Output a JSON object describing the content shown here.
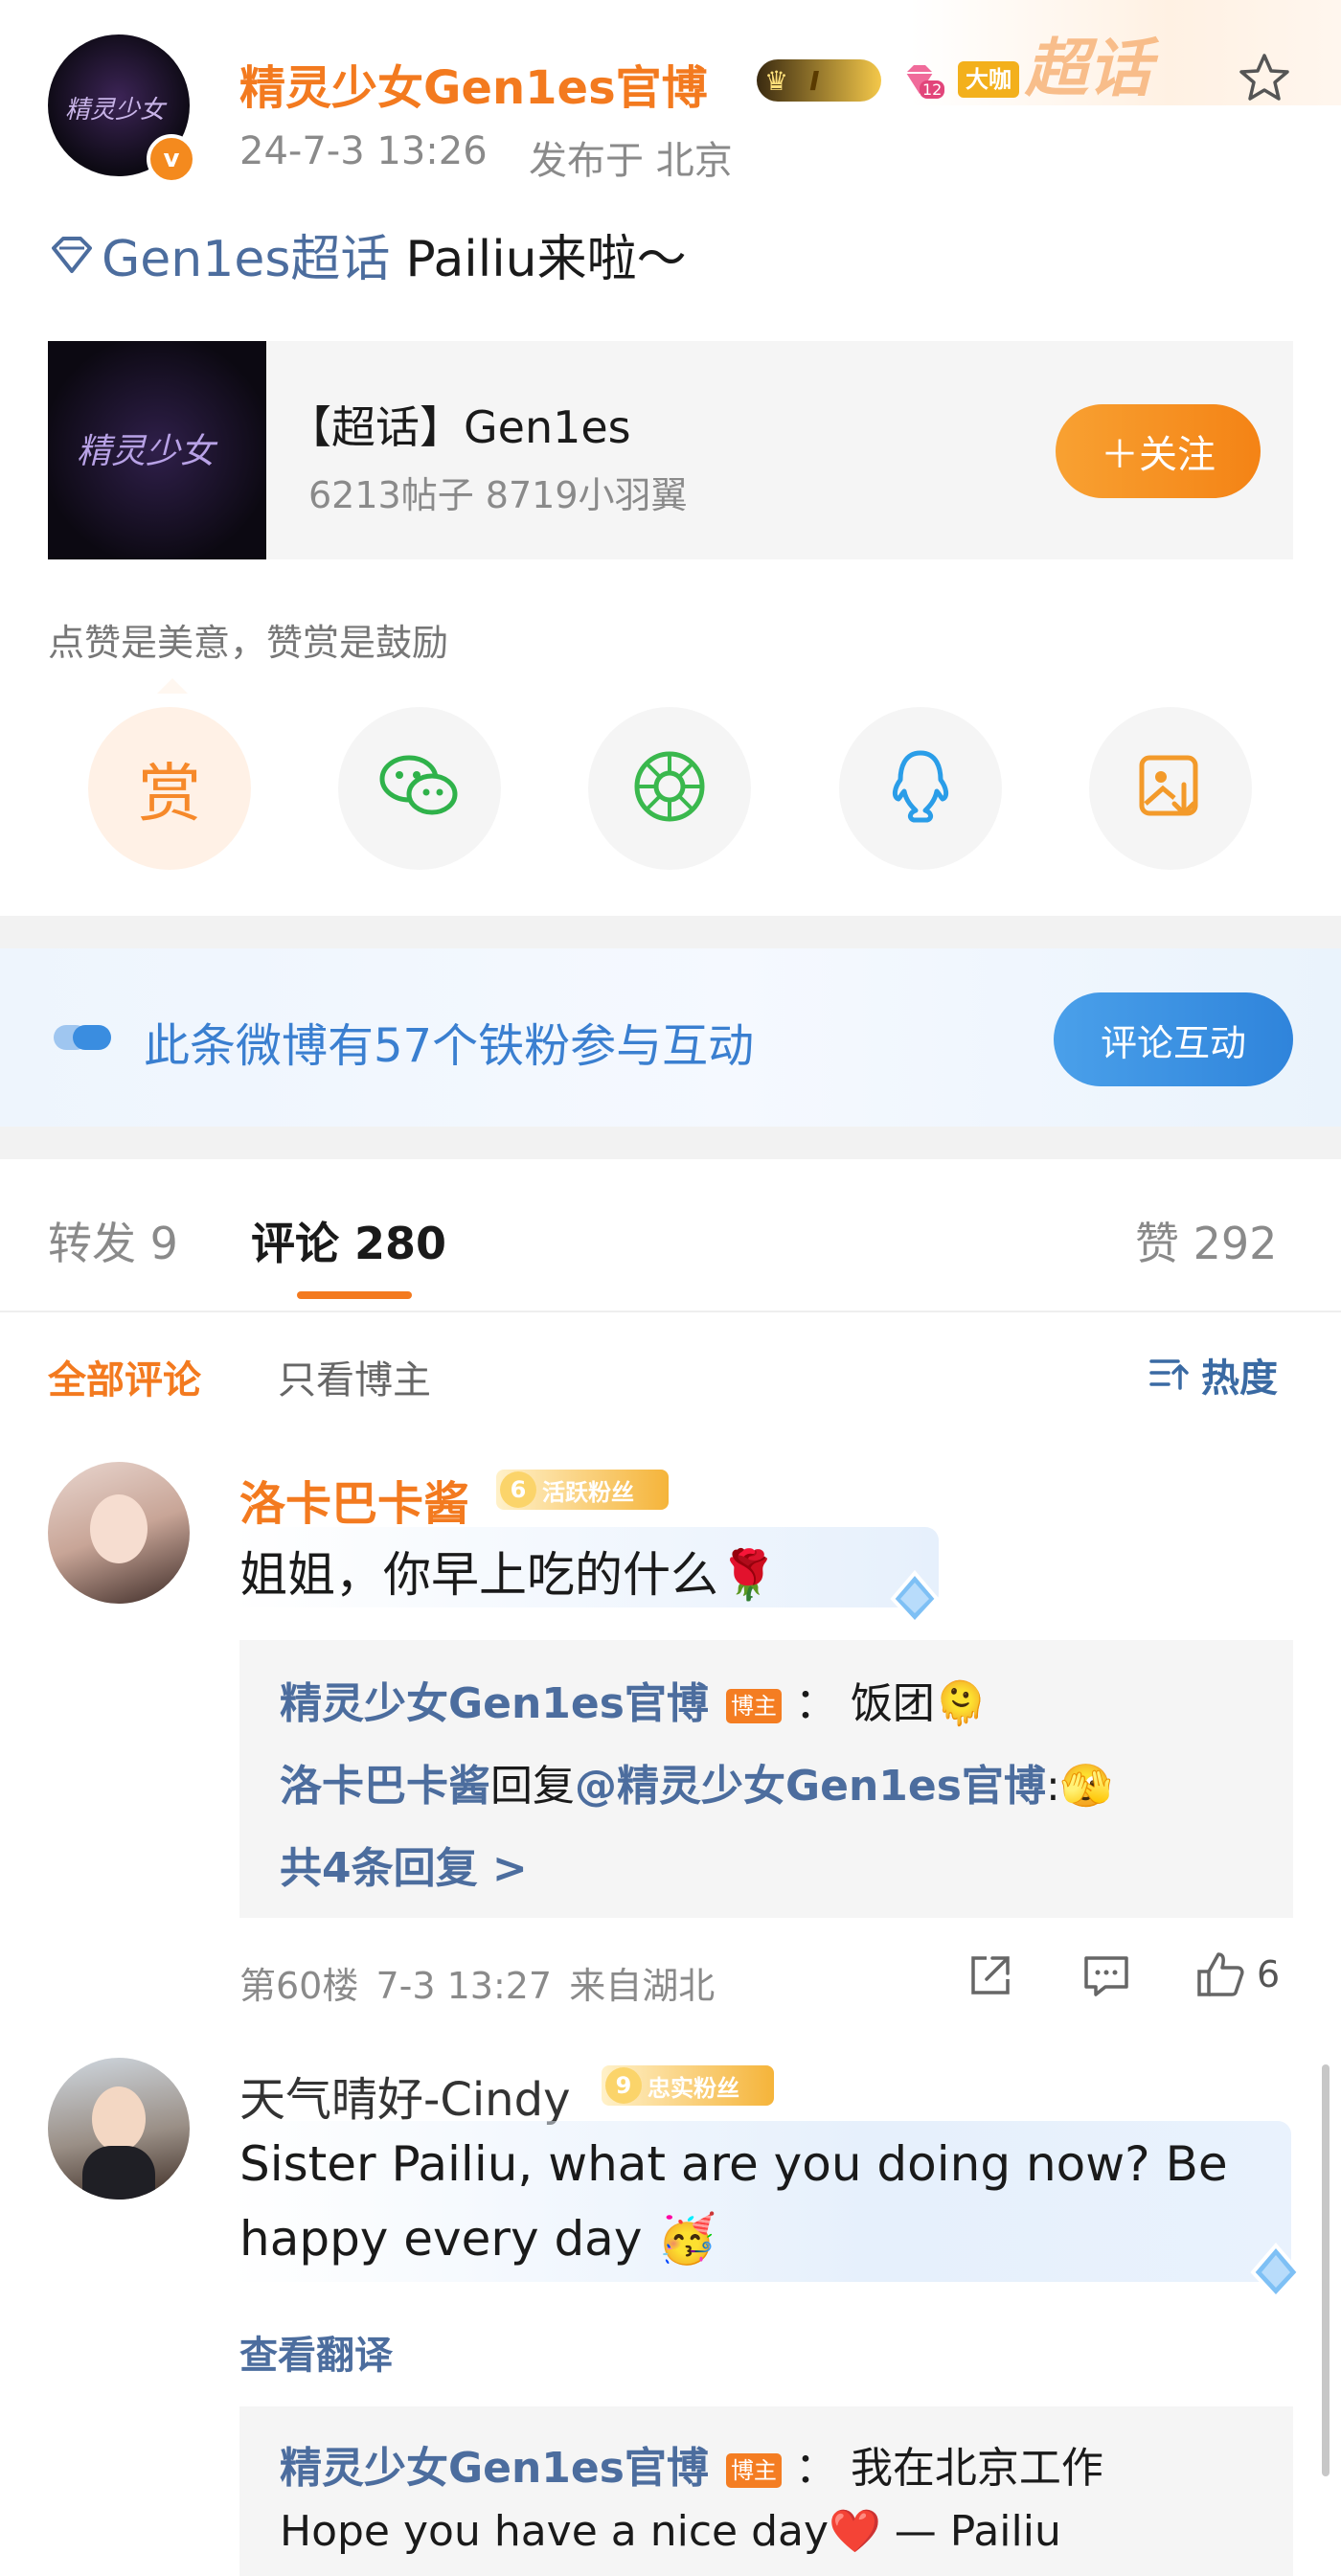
{
  "post": {
    "author": "精灵少女Gen1es官博",
    "time": "24-7-3 13:26",
    "location": "发布于 北京",
    "level_badge": "I",
    "fan_badge": "12",
    "tag_badge": "大咖",
    "watermark": "超话",
    "topic": "Gen1es超话",
    "text": "Pailiu来啦～"
  },
  "supertopic_card": {
    "title": "【超话】Gen1es",
    "stats": "6213帖子 8719小羽翼",
    "follow_button": "＋关注",
    "logo_text": "精灵少女"
  },
  "reward": {
    "caption": "点赞是美意，赞赏是鼓励",
    "reward_label": "赏"
  },
  "share_icons": [
    "wechat-icon",
    "moments-icon",
    "qq-icon",
    "save-image-icon"
  ],
  "fan_banner": {
    "text": "此条微博有57个铁粉参与互动",
    "button": "评论互动"
  },
  "tabs": {
    "repost": "转发 9",
    "comment": "评论 280",
    "like": "赞 292"
  },
  "filters": {
    "all": "全部评论",
    "author_only": "只看博主",
    "sort": "热度"
  },
  "comments": [
    {
      "user": "洛卡巴卡酱",
      "fan_level": "6",
      "fan_label": "活跃粉丝",
      "text": "姐姐，你早上吃的什么🌹",
      "replies": [
        {
          "user": "精灵少女Gen1es官博",
          "tag": "博主",
          "sep": "：",
          "text": "饭团🫠"
        },
        {
          "user": "洛卡巴卡酱",
          "mid": "回复",
          "at": "@精灵少女Gen1es官博",
          "text": ":🫣"
        }
      ],
      "more_replies": "共4条回复 >",
      "floor": "第60楼",
      "time": "7-3 13:27",
      "location": "来自湖北",
      "likes": "6"
    },
    {
      "user": "天气晴好-Cindy",
      "fan_level": "9",
      "fan_label": "忠实粉丝",
      "text_line1": "Sister Pailiu, what are you doing now? Be",
      "text_line2": "happy every day 🥳",
      "translate": "查看翻译",
      "reply": {
        "user": "精灵少女Gen1es官博",
        "tag": "博主",
        "sep": "：",
        "text": "我在北京工作",
        "line2": "Hope you have a nice day❤️ — Pailiu"
      }
    }
  ],
  "colors": {
    "accent": "#f37a1f",
    "link_blue": "#4c6d9e",
    "button_blue": "#3a8de0"
  }
}
